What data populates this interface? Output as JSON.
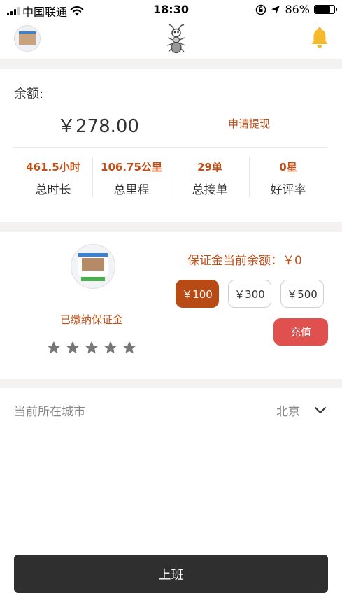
{
  "status_bar": {
    "carrier": "中国联通",
    "time": "18:30",
    "battery": "86%",
    "battery_level": 0.86
  },
  "nav": {
    "avatar_icon": "user-avatar",
    "logo_icon": "ant-logo",
    "bell_icon": "bell-icon",
    "bell_color": "#f5b92b"
  },
  "balance": {
    "label": "余额:",
    "amount": "￥278.00",
    "withdraw_label": "申请提现"
  },
  "stats": [
    {
      "value": "461.5小时",
      "label": "总时长"
    },
    {
      "value": "106.75公里",
      "label": "总里程"
    },
    {
      "value": "29单",
      "label": "总接单"
    },
    {
      "value": "0星",
      "label": "好评率"
    }
  ],
  "deposit": {
    "paid_label": "已缴纳保证金",
    "rating": 0,
    "rating_max": 5,
    "balance_label": "保证金当前余额：￥0",
    "options": [
      "￥100",
      "￥300",
      "￥500"
    ],
    "selected_index": 0,
    "recharge_label": "充值"
  },
  "city": {
    "label": "当前所在城市",
    "value": "北京"
  },
  "start_button": "上班",
  "colors": {
    "accent": "#c0501a",
    "selected_option": "#b84a15",
    "recharge": "#e0504e",
    "start_button": "#2f2f2f"
  }
}
